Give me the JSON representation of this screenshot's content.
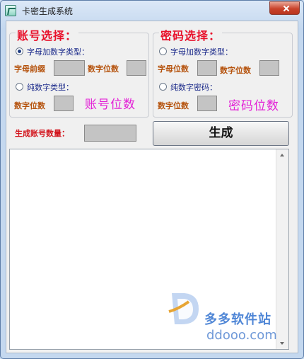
{
  "window": {
    "title": "卡密生成系统"
  },
  "account": {
    "legend": "账号选择：",
    "alnum_option": "字母加数字类型：",
    "prefix_label": "字母前缀",
    "digits_label": "数字位数",
    "numeric_option": "纯数字类型：",
    "numeric_digits_label": "数字位数",
    "big_label": "账号位数"
  },
  "password": {
    "legend": "密码选择：",
    "alnum_option": "字母加数字类型：",
    "letter_digits_label": "字母位数",
    "digits_label": "数字位数",
    "numeric_option": "纯数字密码：",
    "numeric_digits_label": "数字位数",
    "big_label": "密码位数"
  },
  "generate": {
    "count_label": "生成账号数量：",
    "button_label": "生成"
  },
  "watermark": {
    "name": "多多软件站",
    "url": "ddooo.com"
  },
  "colors": {
    "legend": "#e8102a",
    "radio_text": "#1b2a8a",
    "field_label": "#b5520c",
    "big_label": "#e31fd6",
    "count_label": "#d3171f"
  }
}
